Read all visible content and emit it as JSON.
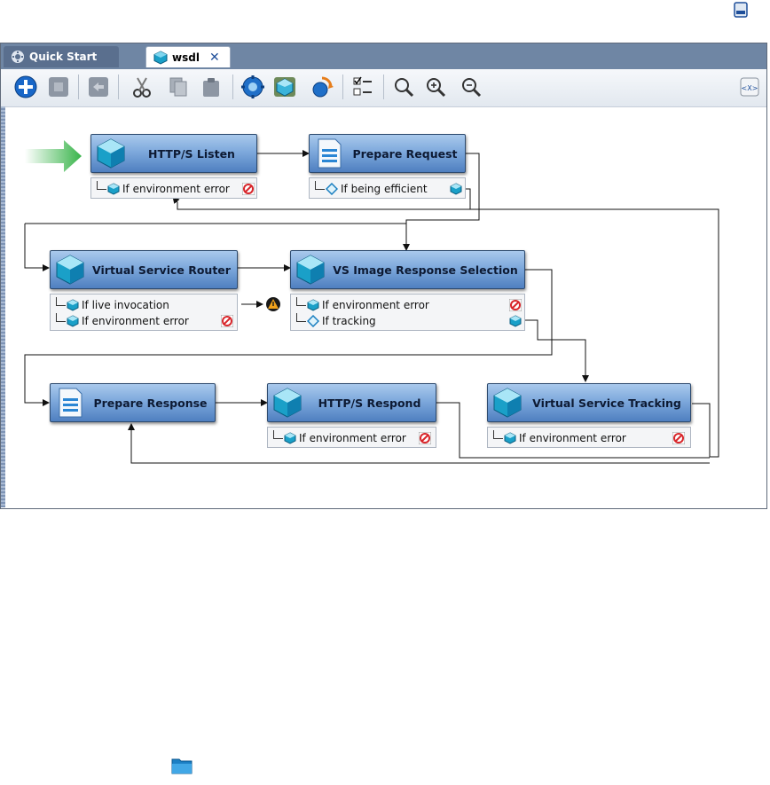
{
  "tabs": [
    {
      "label": "Quick Start",
      "icon": "gear-icon"
    },
    {
      "label": "wsdl",
      "icon": "cube-icon",
      "close": "✕"
    }
  ],
  "toolbar": {
    "buttons": [
      "add-icon",
      "stop-icon",
      "back-icon",
      "cut-icon",
      "copy-icon",
      "paste-icon",
      "settings-icon",
      "model-icon",
      "refresh-icon",
      "checklist-icon",
      "zoom-icon",
      "zoom-in-icon",
      "zoom-out-icon",
      "xml-icon"
    ]
  },
  "nodes": {
    "http_listen": {
      "label": "HTTP/S Listen",
      "branches": [
        {
          "label": "If environment error",
          "end": "error"
        }
      ]
    },
    "prepare_request": {
      "label": "Prepare Request",
      "branches": [
        {
          "label": "If being efficient",
          "end": "cube"
        }
      ]
    },
    "vs_router": {
      "label": "Virtual Service Router",
      "branches": [
        {
          "label": "If live invocation"
        },
        {
          "label": "If environment error",
          "end": "error"
        }
      ]
    },
    "vs_image": {
      "label": "VS Image Response Selection",
      "branches": [
        {
          "label": "If environment error",
          "end": "error"
        },
        {
          "label": "If tracking",
          "end": "cube"
        }
      ]
    },
    "prepare_response": {
      "label": "Prepare Response"
    },
    "http_respond": {
      "label": "HTTP/S Respond",
      "branches": [
        {
          "label": "If environment error",
          "end": "error"
        }
      ]
    },
    "vs_tracking": {
      "label": "Virtual Service Tracking",
      "branches": [
        {
          "label": "If environment error",
          "end": "error"
        }
      ]
    }
  },
  "colors": {
    "accent": "#1f4f9a",
    "node_top": "#a9c9ec",
    "node_bottom": "#4f7fc0",
    "tab_bar": "#6f86a4",
    "start_arrow": "#3bb54a",
    "error": "#d8262b"
  }
}
